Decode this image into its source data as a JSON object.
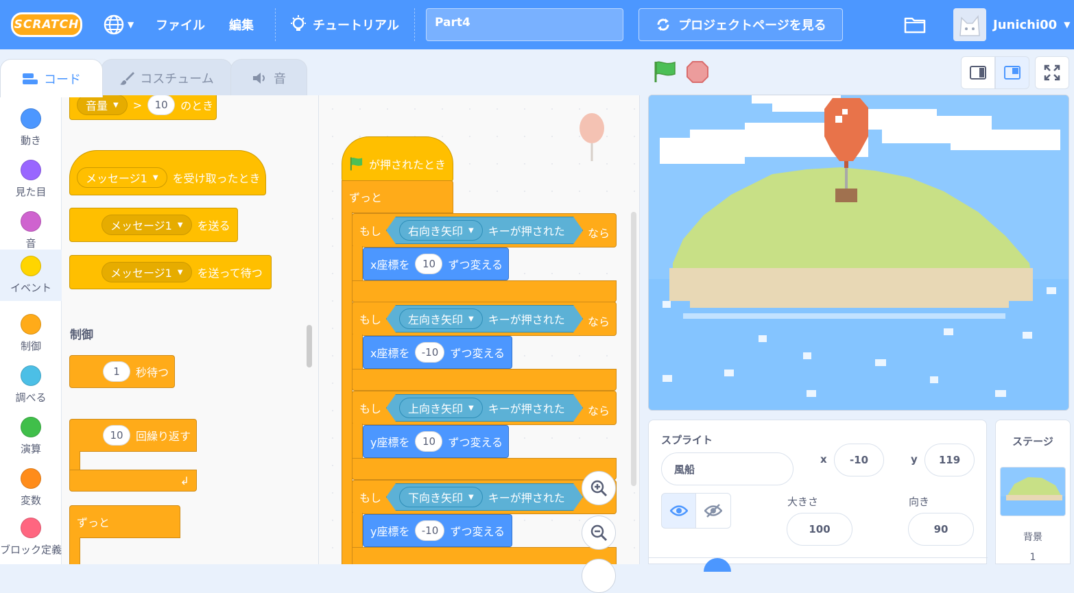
{
  "menubar": {
    "logo": "SCRATCH",
    "file": "ファイル",
    "edit": "編集",
    "tutorial": "チュートリアル",
    "project_title": "Part4",
    "see_project_page": "プロジェクトページを見る",
    "username": "Junichi00"
  },
  "tabs": {
    "code": "コード",
    "costumes": "コスチューム",
    "sounds": "音"
  },
  "categories": [
    {
      "label": "動き",
      "color": "#4c97ff"
    },
    {
      "label": "見た目",
      "color": "#9966ff"
    },
    {
      "label": "音",
      "color": "#cf63cf"
    },
    {
      "label": "イベント",
      "color": "#ffd500"
    },
    {
      "label": "制御",
      "color": "#ffab19"
    },
    {
      "label": "調べる",
      "color": "#4cbfe6"
    },
    {
      "label": "演算",
      "color": "#40bf4a"
    },
    {
      "label": "変数",
      "color": "#ff8c1a"
    },
    {
      "label": "ブロック定義",
      "color": "#ff6680"
    }
  ],
  "palette": {
    "when_loudness": {
      "dropdown": "音量",
      "op": ">",
      "value": "10",
      "suffix": "のとき"
    },
    "when_receive": {
      "dropdown": "メッセージ1",
      "suffix": "を受け取ったとき"
    },
    "broadcast": {
      "dropdown": "メッセージ1",
      "suffix": "を送る"
    },
    "broadcast_wait": {
      "dropdown": "メッセージ1",
      "suffix": "を送って待つ"
    },
    "control_title": "制御",
    "wait": {
      "value": "1",
      "suffix": "秒待つ"
    },
    "repeat": {
      "value": "10",
      "suffix": "回繰り返す"
    },
    "forever": "ずっと"
  },
  "script": {
    "hat": "が押されたとき",
    "forever": "ずっと",
    "if_label": "もし",
    "then_label": "なら",
    "key_pressed": "キーが押された",
    "ifs": [
      {
        "key": "右向き矢印",
        "action_prefix": "x座標を",
        "value": "10",
        "action_suffix": "ずつ変える"
      },
      {
        "key": "左向き矢印",
        "action_prefix": "x座標を",
        "value": "-10",
        "action_suffix": "ずつ変える"
      },
      {
        "key": "上向き矢印",
        "action_prefix": "y座標を",
        "value": "10",
        "action_suffix": "ずつ変える"
      },
      {
        "key": "下向き矢印",
        "action_prefix": "y座標を",
        "value": "-10",
        "action_suffix": "ずつ変える"
      }
    ]
  },
  "sprite_info": {
    "title": "スプライト",
    "name": "風船",
    "x_label": "x",
    "x": "-10",
    "y_label": "y",
    "y": "119",
    "size_label": "大きさ",
    "size": "100",
    "direction_label": "向き",
    "direction": "90"
  },
  "stage_panel": {
    "title": "ステージ",
    "backdrop_label": "背景",
    "backdrop_count": "1"
  }
}
